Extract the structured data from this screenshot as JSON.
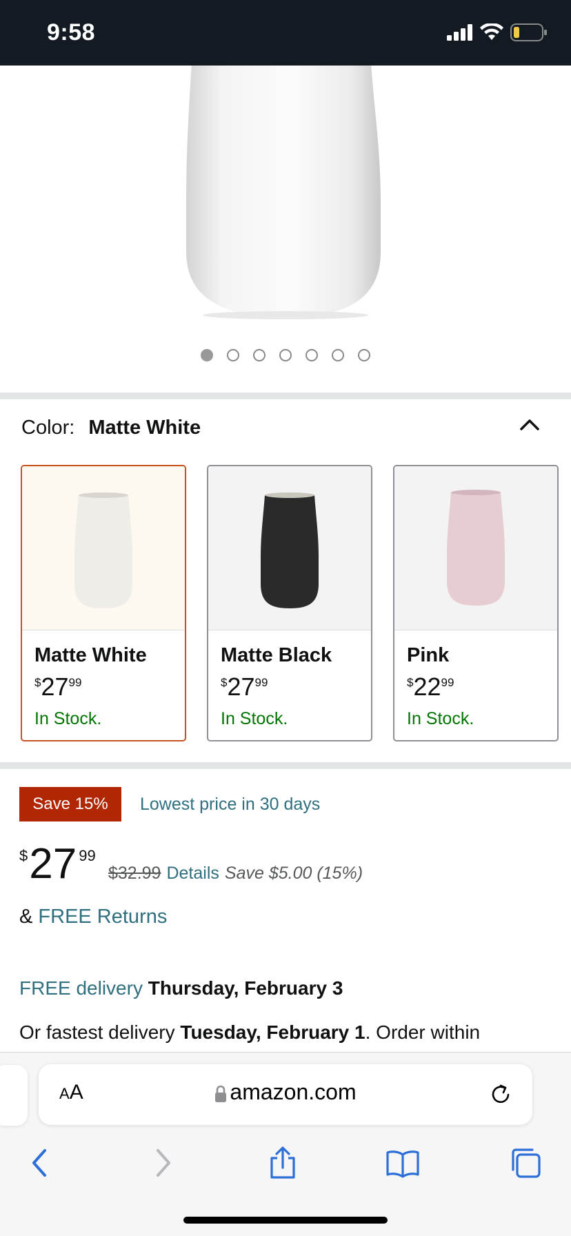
{
  "status_bar": {
    "time": "9:58"
  },
  "gallery": {
    "dot_count": 7,
    "active_index": 0
  },
  "color_selector": {
    "label": "Color:",
    "selected": "Matte White",
    "options": [
      {
        "name": "Matte White",
        "currency": "$",
        "whole": "27",
        "cents": "99",
        "stock": "In Stock."
      },
      {
        "name": "Matte Black",
        "currency": "$",
        "whole": "27",
        "cents": "99",
        "stock": "In Stock."
      },
      {
        "name": "Pink",
        "currency": "$",
        "whole": "22",
        "cents": "99",
        "stock": "In Stock."
      }
    ]
  },
  "deal": {
    "badge": "Save 15%",
    "lowest_price": "Lowest price in 30 days",
    "currency": "$",
    "whole": "27",
    "cents": "99",
    "list_price": "$32.99",
    "details": "Details",
    "savings": "Save $5.00 (15%)",
    "returns_prefix": "&",
    "returns_link": "FREE Returns"
  },
  "delivery": {
    "free_label": "FREE delivery",
    "free_date": "Thursday, February 3",
    "fastest_prefix": "Or fastest delivery",
    "fastest_date": "Tuesday, February 1",
    "fastest_suffix": ". Order within"
  },
  "browser": {
    "aa_small": "A",
    "aa_large": "A",
    "url": "amazon.com"
  },
  "colors": {
    "status_bg": "#131a22",
    "link": "#2f6f80",
    "in_stock": "#007600",
    "deal_badge": "#b12704",
    "selected_border": "#c7511f",
    "ios_blue": "#2c6fd8"
  }
}
